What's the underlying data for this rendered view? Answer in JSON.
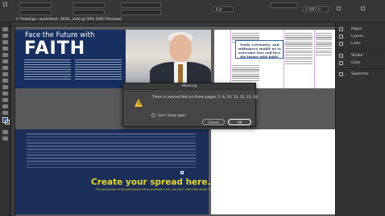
{
  "app": {
    "document_tab": "*Indesign- worksheet- 2020_.indd @ 50% [GPU Preview]",
    "zoom_value": "0.1667 in",
    "font_size": "8 pt"
  },
  "layout_left": {
    "header": "Face the Future with",
    "title": "FAITH"
  },
  "layout_right": {
    "quote": "Truth, covenants, and ordinances enable us to overcome fear and face the future with faith!"
  },
  "bottom_spread": {
    "cta_title": "Create your spread here.",
    "cta_subtitle": "The first portion of the article/story will be provided in full, and you'll match the design from the previous two pages."
  },
  "dialog": {
    "title": "Warning",
    "message": "There is overset text on these pages: 5, 8, 10, 13, 12, 15, 18.",
    "checkbox_label": "Don't show again",
    "cancel_label": "Cancel",
    "ok_label": "OK"
  },
  "panels": [
    {
      "label": "Pages",
      "icon": "pages-icon"
    },
    {
      "label": "Layers",
      "icon": "layers-icon"
    },
    {
      "label": "Links",
      "icon": "links-icon"
    },
    {
      "label": "Stroke",
      "icon": "stroke-icon"
    },
    {
      "label": "Color",
      "icon": "color-icon"
    },
    {
      "label": "Swatches",
      "icon": "swatches-icon"
    }
  ],
  "colors": {
    "spread_navy": "#18305f",
    "accent_yellow": "#e8d52c",
    "quote_border": "#2f67a8",
    "warning_yellow": "#f2c12e"
  }
}
